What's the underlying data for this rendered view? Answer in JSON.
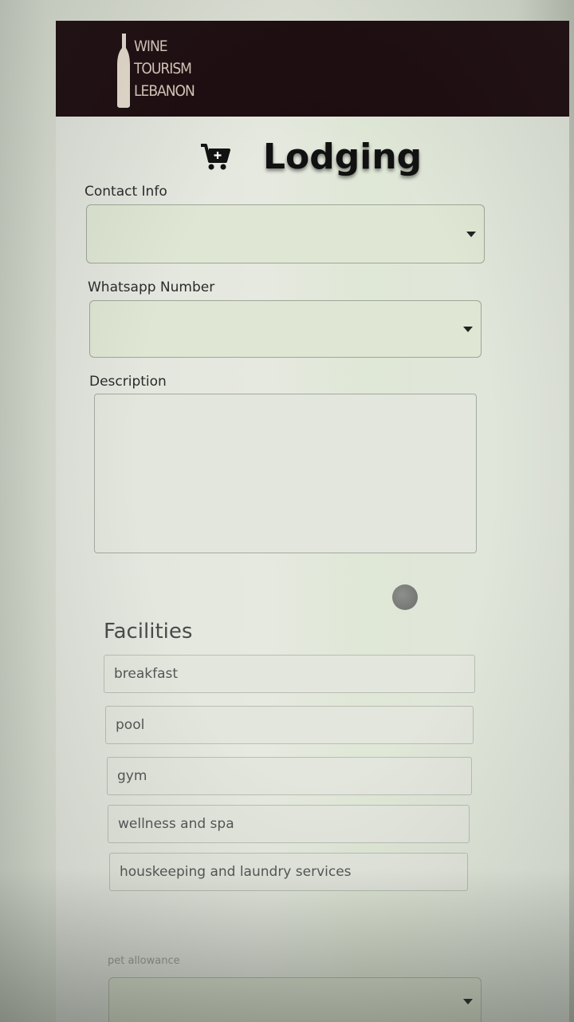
{
  "header": {
    "logo_lines": [
      "wine",
      "tourism",
      "lebanon"
    ],
    "logo_text_display": [
      "WINE",
      "TOURISM",
      "LEBANON"
    ]
  },
  "page": {
    "title": "Lodging",
    "title_icon": "cart-plus-icon"
  },
  "form": {
    "contact_info_label": "Contact Info",
    "contact_info_value": "",
    "whatsapp_label": "Whatsapp Number",
    "whatsapp_value": "",
    "description_label": "Description",
    "description_value": ""
  },
  "facilities": {
    "title": "Facilities",
    "items": [
      "breakfast",
      "pool",
      "gym",
      "wellness and spa",
      "houskeeping and laundry services"
    ]
  },
  "pet": {
    "label": "pet allowance",
    "value": ""
  },
  "colors": {
    "header_bg": "#1d0c10",
    "field_fill": "#dfe6d3",
    "title_text": "#111111"
  }
}
